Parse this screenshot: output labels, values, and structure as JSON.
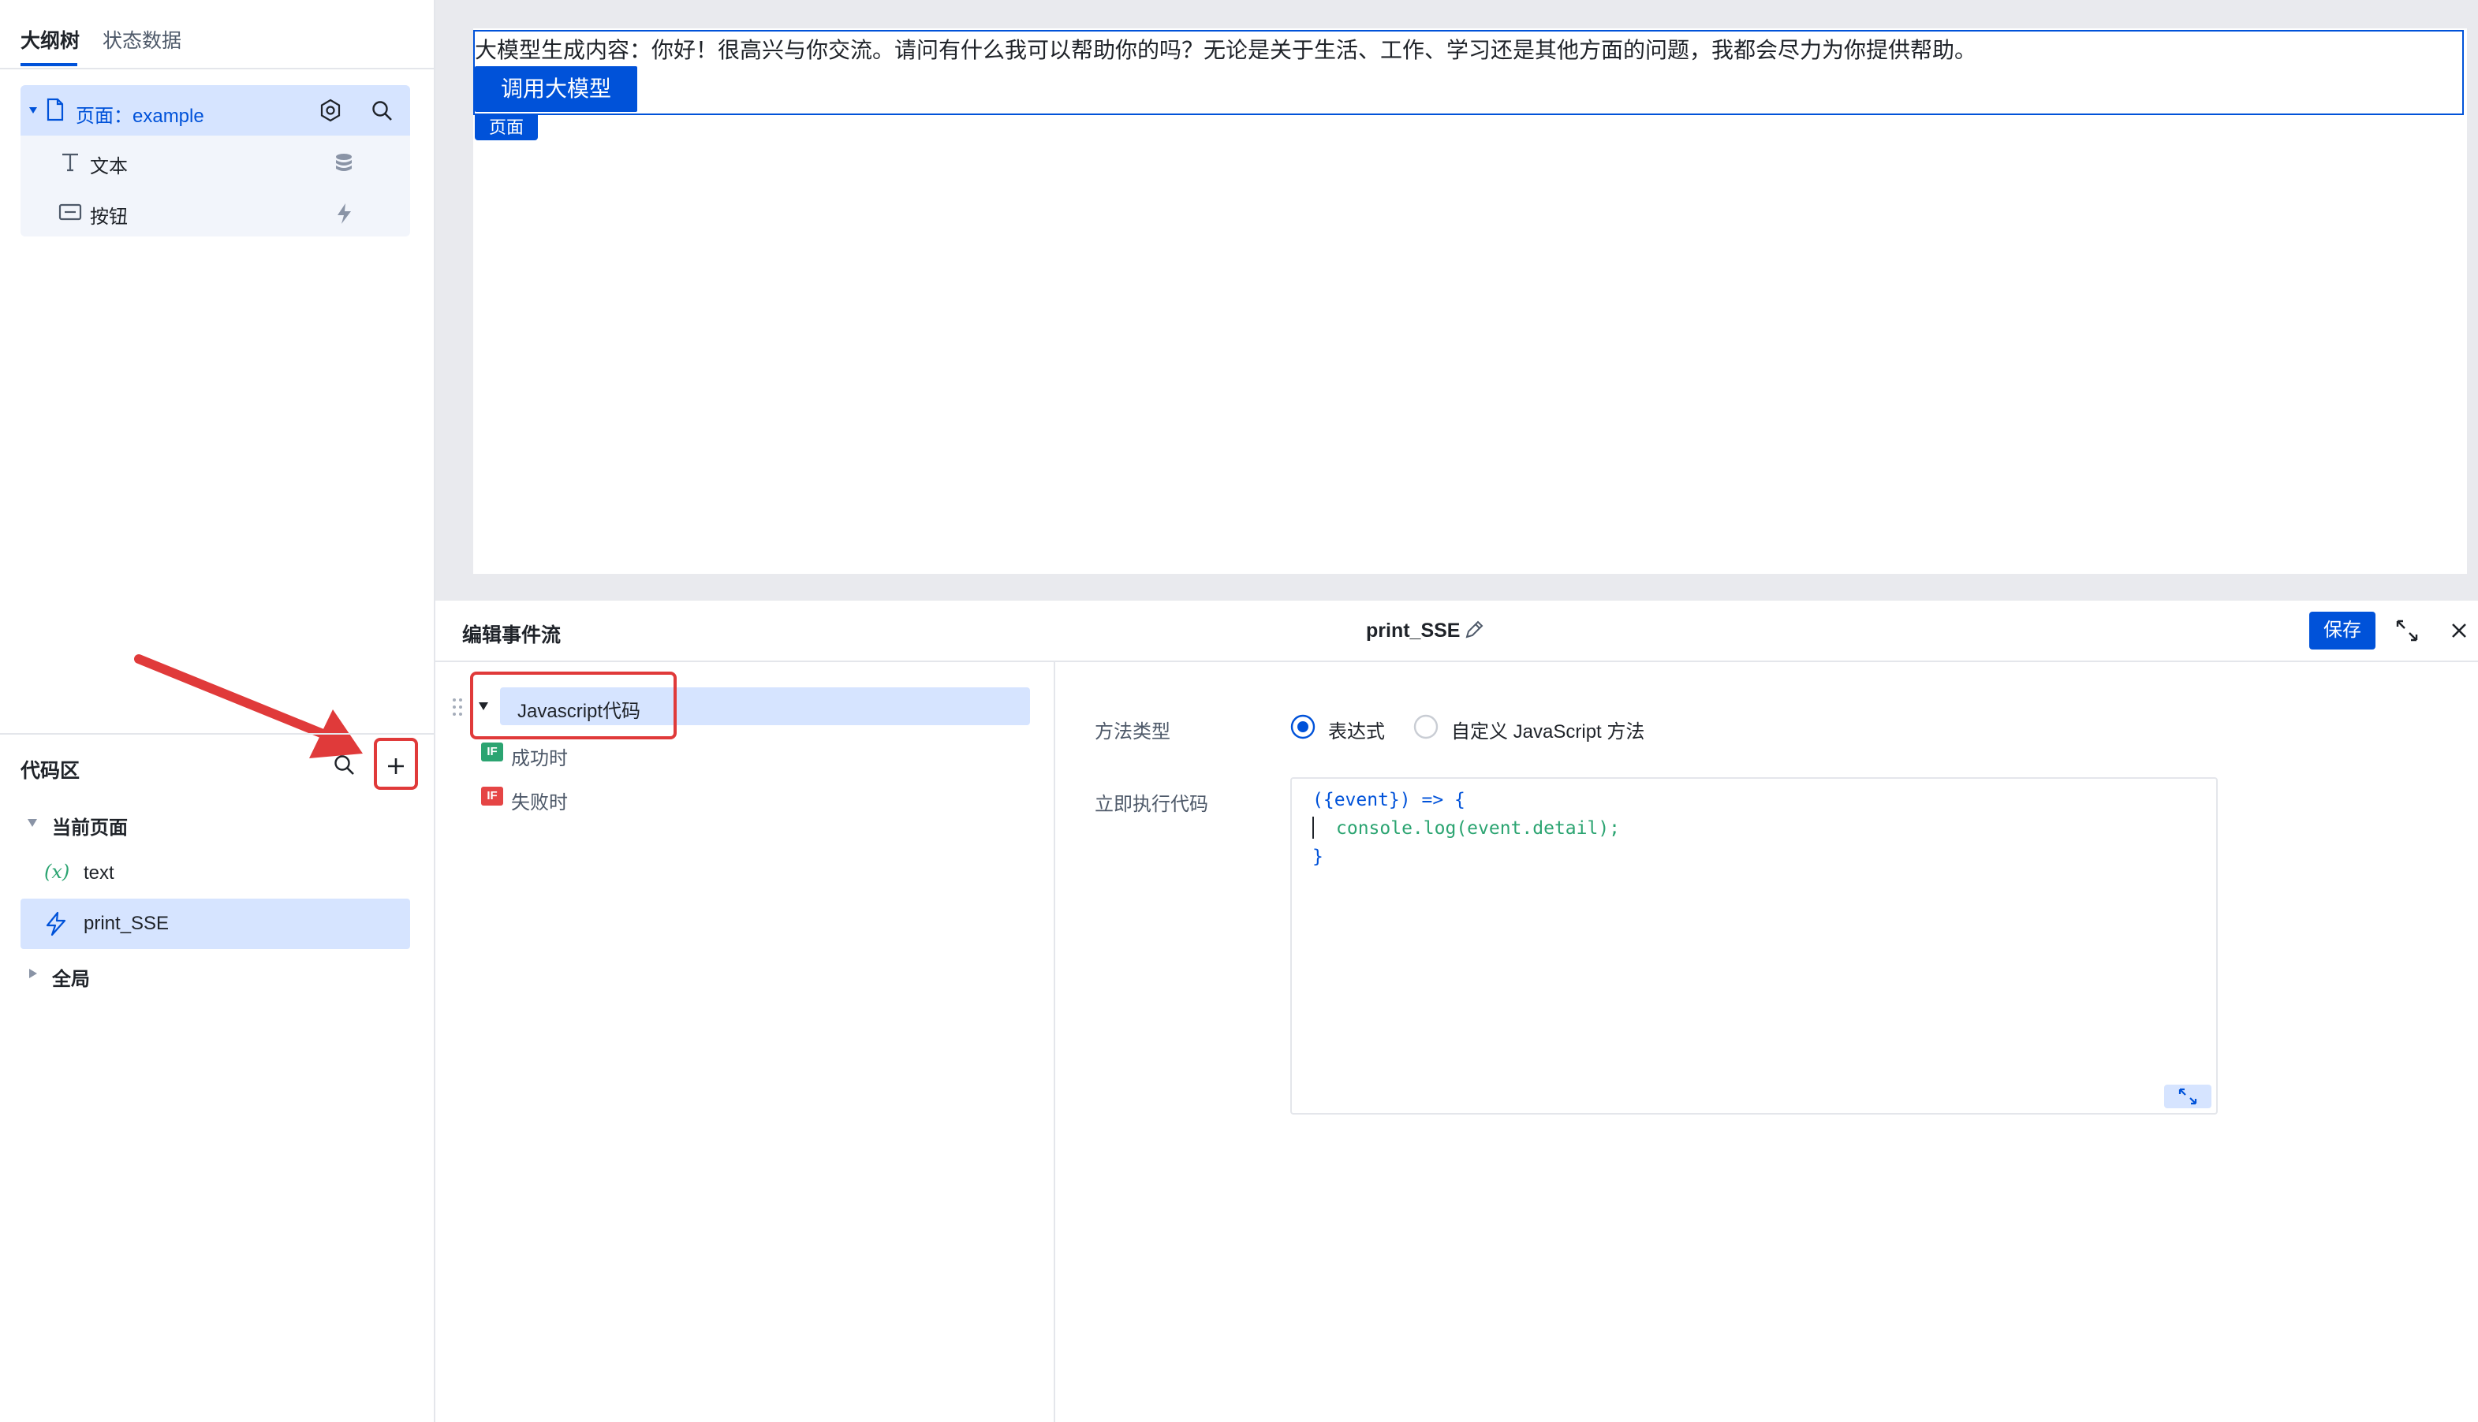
{
  "left_panel": {
    "tabs": [
      {
        "label": "大纲树",
        "active": true
      },
      {
        "label": "状态数据",
        "active": false
      }
    ],
    "tree": {
      "page_label": "页面：example",
      "children": [
        {
          "label": "文本",
          "icon": "text-type-icon",
          "action_icon": "database-icon"
        },
        {
          "label": "按钮",
          "icon": "button-component-icon",
          "action_icon": "lightning-icon"
        }
      ]
    },
    "code_area": {
      "title": "代码区",
      "groups": [
        {
          "label": "当前页面",
          "expanded": true
        },
        {
          "label": "全局",
          "expanded": false
        }
      ],
      "items": [
        {
          "label": "text",
          "icon": "variable-icon"
        },
        {
          "label": "print_SSE",
          "icon": "lightning-icon",
          "selected": true
        }
      ]
    }
  },
  "canvas": {
    "generated_text": "大模型生成内容：你好！很高兴与你交流。请问有什么我可以帮助你的吗？无论是关于生活、工作、学习还是其他方面的问题，我都会尽力为你提供帮助。",
    "button_label": "调用大模型",
    "page_tag": "页面"
  },
  "event_flow": {
    "title": "编辑事件流",
    "flow_name": "print_SSE",
    "save_label": "保存",
    "nodes": {
      "js_label": "Javascript代码",
      "success_label": "成功时",
      "failure_label": "失败时",
      "if_badge": "IF"
    },
    "props": {
      "method_type_label": "方法类型",
      "options": [
        "表达式",
        "自定义 JavaScript 方法"
      ],
      "selected_option": "表达式",
      "exec_label": "立即执行代码",
      "code_lines": [
        "({event}) => {",
        "console.log(event.detail);",
        "}"
      ]
    }
  },
  "colors": {
    "primary": "#0052d9",
    "selected_bg": "#d6e4ff",
    "highlight_red": "#e03a3a",
    "success_green": "#2ba471",
    "fail_red": "#e54545"
  }
}
